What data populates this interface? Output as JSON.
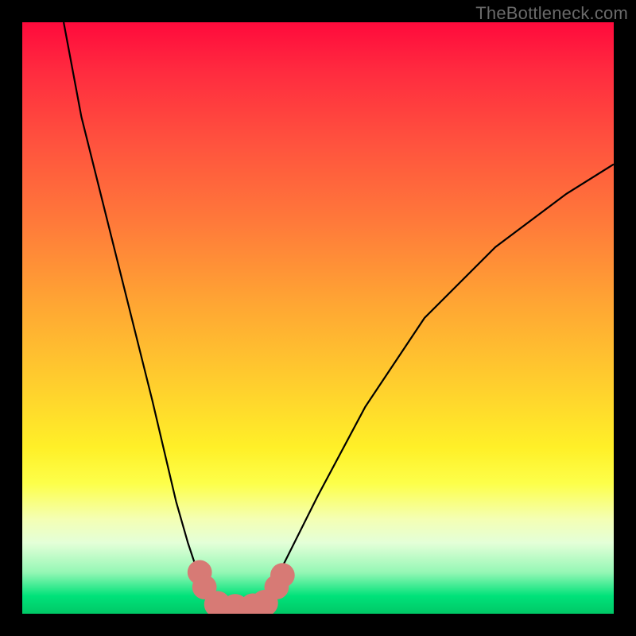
{
  "watermark": "TheBottleneck.com",
  "chart_data": {
    "type": "line",
    "title": "",
    "xlabel": "",
    "ylabel": "",
    "xlim": [
      0,
      100
    ],
    "ylim": [
      0,
      100
    ],
    "series": [
      {
        "name": "left-branch",
        "x": [
          7,
          10,
          14,
          18,
          22,
          26,
          28,
          30,
          32
        ],
        "y": [
          100,
          84,
          68,
          52,
          36,
          19,
          12,
          6,
          3
        ]
      },
      {
        "name": "valley-floor",
        "x": [
          32,
          35,
          38,
          41
        ],
        "y": [
          1.5,
          1.0,
          1.0,
          1.5
        ]
      },
      {
        "name": "right-branch",
        "x": [
          41,
          44,
          50,
          58,
          68,
          80,
          92,
          100
        ],
        "y": [
          3,
          8,
          20,
          35,
          50,
          62,
          71,
          76
        ]
      }
    ],
    "markers": [
      {
        "x": 30.0,
        "y": 7.0,
        "r": 1.4
      },
      {
        "x": 30.8,
        "y": 4.5,
        "r": 1.4
      },
      {
        "x": 33.0,
        "y": 1.6,
        "r": 1.6
      },
      {
        "x": 36.0,
        "y": 1.1,
        "r": 1.6
      },
      {
        "x": 39.0,
        "y": 1.2,
        "r": 1.6
      },
      {
        "x": 41.0,
        "y": 1.8,
        "r": 1.6
      },
      {
        "x": 43.0,
        "y": 4.5,
        "r": 1.4
      },
      {
        "x": 44.0,
        "y": 6.5,
        "r": 1.4
      }
    ],
    "valley_segment": {
      "x1": 33,
      "x2": 41,
      "y": 1.3
    },
    "colors": {
      "curve": "#000000",
      "markers": "#d77a75",
      "gradient_top": "#ff0a3c",
      "gradient_bottom": "#00c866"
    }
  }
}
